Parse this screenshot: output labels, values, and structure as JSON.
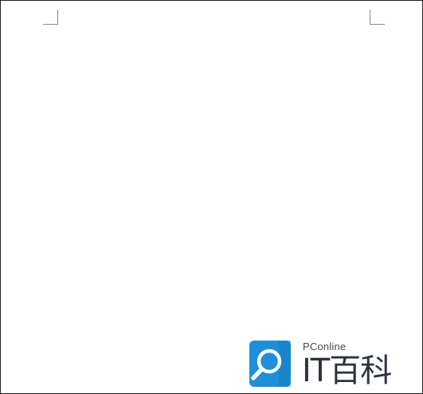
{
  "document": {
    "page_margin_marks": [
      "top-left",
      "top-right"
    ]
  },
  "watermark": {
    "icon": "magnifier-document-icon",
    "brand": "PConline",
    "title": "IT百科",
    "colors": {
      "icon_blue": "#1e8fd8",
      "text_dark": "#2d3440",
      "brand_gray": "#4a4a4a"
    }
  }
}
